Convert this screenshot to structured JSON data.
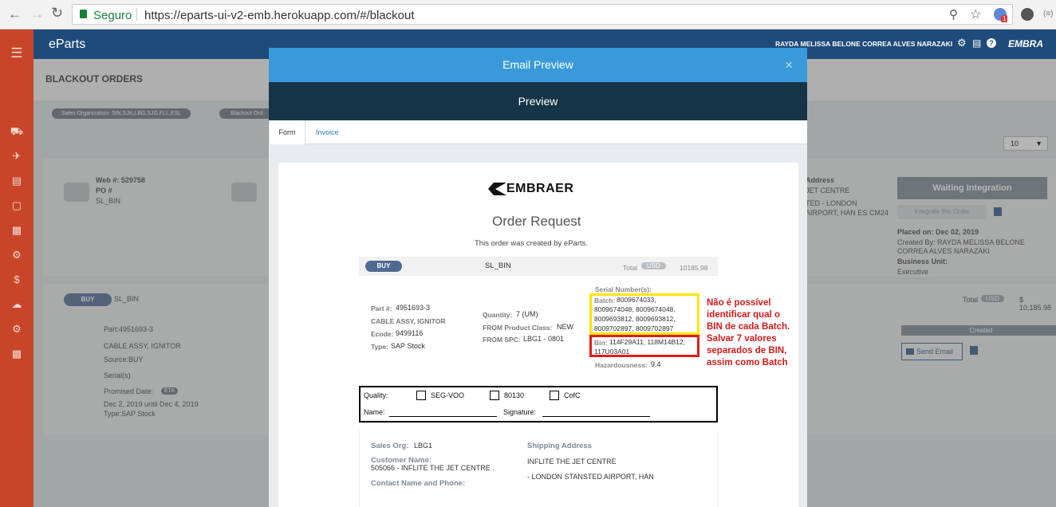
{
  "browser": {
    "secure_label": "Seguro",
    "url": "https://eparts-ui-v2-emb.herokuapp.com/#/blackout",
    "ext_badge": "1"
  },
  "app": {
    "brand": "eParts",
    "user_name": "RAYDA MELISSA BELONE CORREA ALVES NARAZAKI",
    "logo_text": "EMBRA",
    "page_title": "BLACKOUT ORDERS",
    "filter_chip_1": "Sales Organization: SIN,SJK,LBG,SJG,FLL,ESL",
    "filter_chip_2": "Blackout Ord",
    "page_size": "10"
  },
  "background_order": {
    "web_label": "Web #: 529758",
    "po_label": "PO #",
    "po_value": "SL_BIN",
    "addr_label": "Address",
    "addr_line1": "JET CENTRE",
    "addr_line2": "TED - LONDON",
    "addr_line3": "AIRPORT, HAN ES CM24",
    "status_button": "Waiting Integration",
    "integrate_button": "Integrate this Order",
    "placed_on": "Placed on: Dec 02, 2019",
    "created_by_1": "Created By: RAYDA MELISSA BELONE",
    "created_by_2": "CORREA ALVES NARAZAKI",
    "business_unit_label": "Business Unit:",
    "business_unit_value": "Executive",
    "buy_badge": "BUY",
    "buy_name": "SL_BIN",
    "part_line": "Part:4951693-3",
    "part_desc": "CABLE ASSY, IGNITOR",
    "source": "Source:BUY",
    "serials": "Serial(s)",
    "promised_date": "Promised Date:",
    "eta_badge": "ETA",
    "date_range": "Dec 2, 2019 until Dec 4, 2019",
    "type_line": "Type:SAP Stock",
    "total_label": "Total",
    "total_currency": "USD",
    "total_value": "$ 10,185.98",
    "created_badge": "Created",
    "send_email": "Send Email"
  },
  "modal": {
    "title": "Email Preview",
    "subtitle": "Preview",
    "close": "×",
    "tabs": [
      "Form",
      "Invoice"
    ]
  },
  "email": {
    "logo": "EMBRAER",
    "heading": "Order Request",
    "intro": "This order was created by eParts.",
    "buy_badge": "BUY",
    "order_name": "SL_BIN",
    "total_label": "Total",
    "total_currency": "USD",
    "total_value": "10185.98",
    "part_label": "Part #:",
    "part_value": "4951693-3",
    "part_desc": "CABLE ASSY, IGNITOR",
    "ecode_label": "Ecode:",
    "ecode_value": "9499116",
    "type_label": "Type:",
    "type_value": "SAP Stock",
    "qty_label": "Quantity:",
    "qty_value": "7 (UM)",
    "class_label": "FROM Product Class:",
    "class_value": "NEW",
    "spc_label": "FROM SPC:",
    "spc_value": "LBG1 - 0801",
    "serial_label": "Serial Number(s):",
    "batch_label": "Batch:",
    "batch_line1": "8009674033,",
    "batch_line2": "8009674048, 8009674048,",
    "batch_line3": "8009693812, 8009693812,",
    "batch_line4": "8009702897, 8009702897",
    "bin_label": "Bin:",
    "bin_line1": "114F29A11, 118M14B12,",
    "bin_line2": "117U03A01",
    "haz_label": "Hazardousness:",
    "haz_value": "9.4",
    "quality_label": "Quality:",
    "q_opt1": "SEG-VOO",
    "q_opt2": "80130",
    "q_opt3": "CofC",
    "name_label": "Name:",
    "signature_label": "Signature:",
    "sales_org_label": "Sales Org:",
    "sales_org_value": "LBG1",
    "customer_label": "Customer Name:",
    "customer_value": "505066 - INFLITE THE JET CENTRE .",
    "contact_label": "Contact Name and Phone:",
    "ship_label": "Shipping Address",
    "ship_line1": "INFLITE THE JET CENTRE",
    "ship_line2": "- LONDON STANSTED AIRPORT, HAN"
  },
  "annotation": {
    "line1": "Não é possível",
    "line2": "identificar qual o",
    "line3": "BIN de cada Batch.",
    "line4": "Salvar 7 valores",
    "line5": "separados de BIN,",
    "line6": "assim como Batch"
  },
  "colors": {
    "sidebar": "#c9452a",
    "topnav": "#1f4b7a",
    "modal_header": "#3a9ad9",
    "modal_subheader": "#163447",
    "highlight_yellow": "#ffe600",
    "highlight_red": "#e01b1b"
  }
}
